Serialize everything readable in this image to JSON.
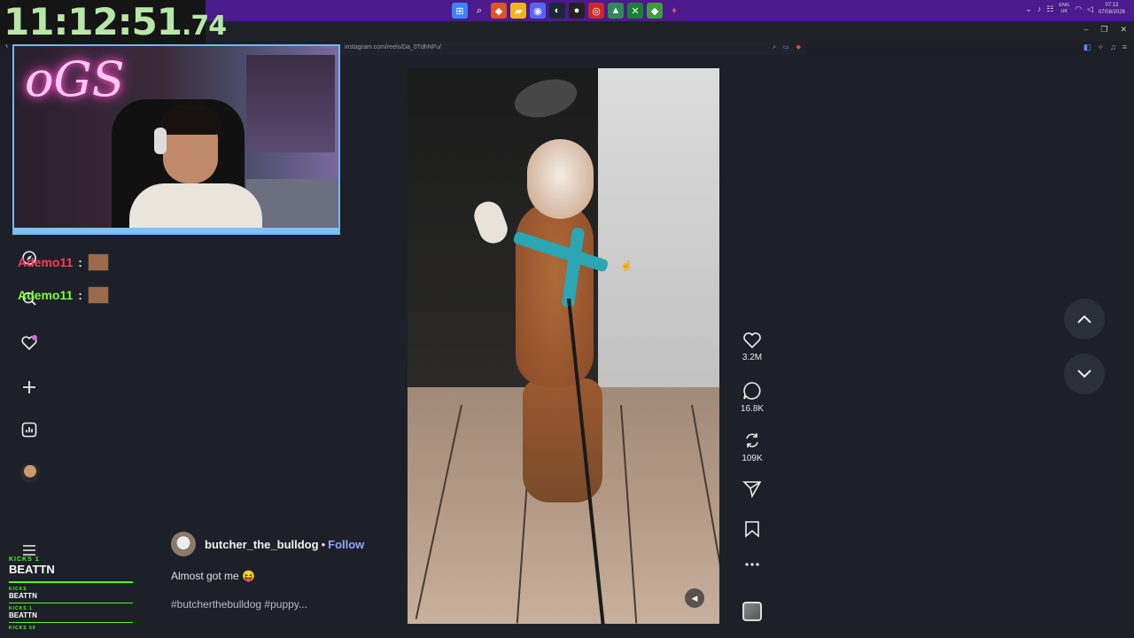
{
  "timer": {
    "main": "11:12:51",
    "fraction": ".74"
  },
  "taskbar": {
    "lang": "ENG",
    "region": "UK",
    "time": "07:13",
    "date": "07/08/2026"
  },
  "browser": {
    "url": "instagram.com/reels/Da_0TdhNFu/"
  },
  "chat": {
    "messages": [
      {
        "user": "Ademo11",
        "sep": ":"
      },
      {
        "user": "Ademo11",
        "sep": ":"
      }
    ]
  },
  "kick": {
    "top_label": "KICKS 1",
    "top_name": "BEATTN",
    "rows": [
      {
        "label": "KICKS",
        "name": "BEATTN"
      },
      {
        "label": "KICKS 1",
        "name": "BEATTN"
      },
      {
        "label": "KICKS 50",
        "name": ""
      }
    ]
  },
  "post": {
    "author": "butcher_the_bulldog",
    "dot": "•",
    "follow": "Follow",
    "caption": "Almost got me 😝",
    "hashtags": "#butcherthebulldog #puppy..."
  },
  "actions": {
    "likes": "3.2M",
    "comments": "16.8K",
    "reposts": "109K"
  },
  "colors": {
    "taskbar": "#4b1a8c",
    "kick_green": "#53fc18",
    "follow_link": "#8fa8ff",
    "timer_text": "#b8e6a8"
  }
}
